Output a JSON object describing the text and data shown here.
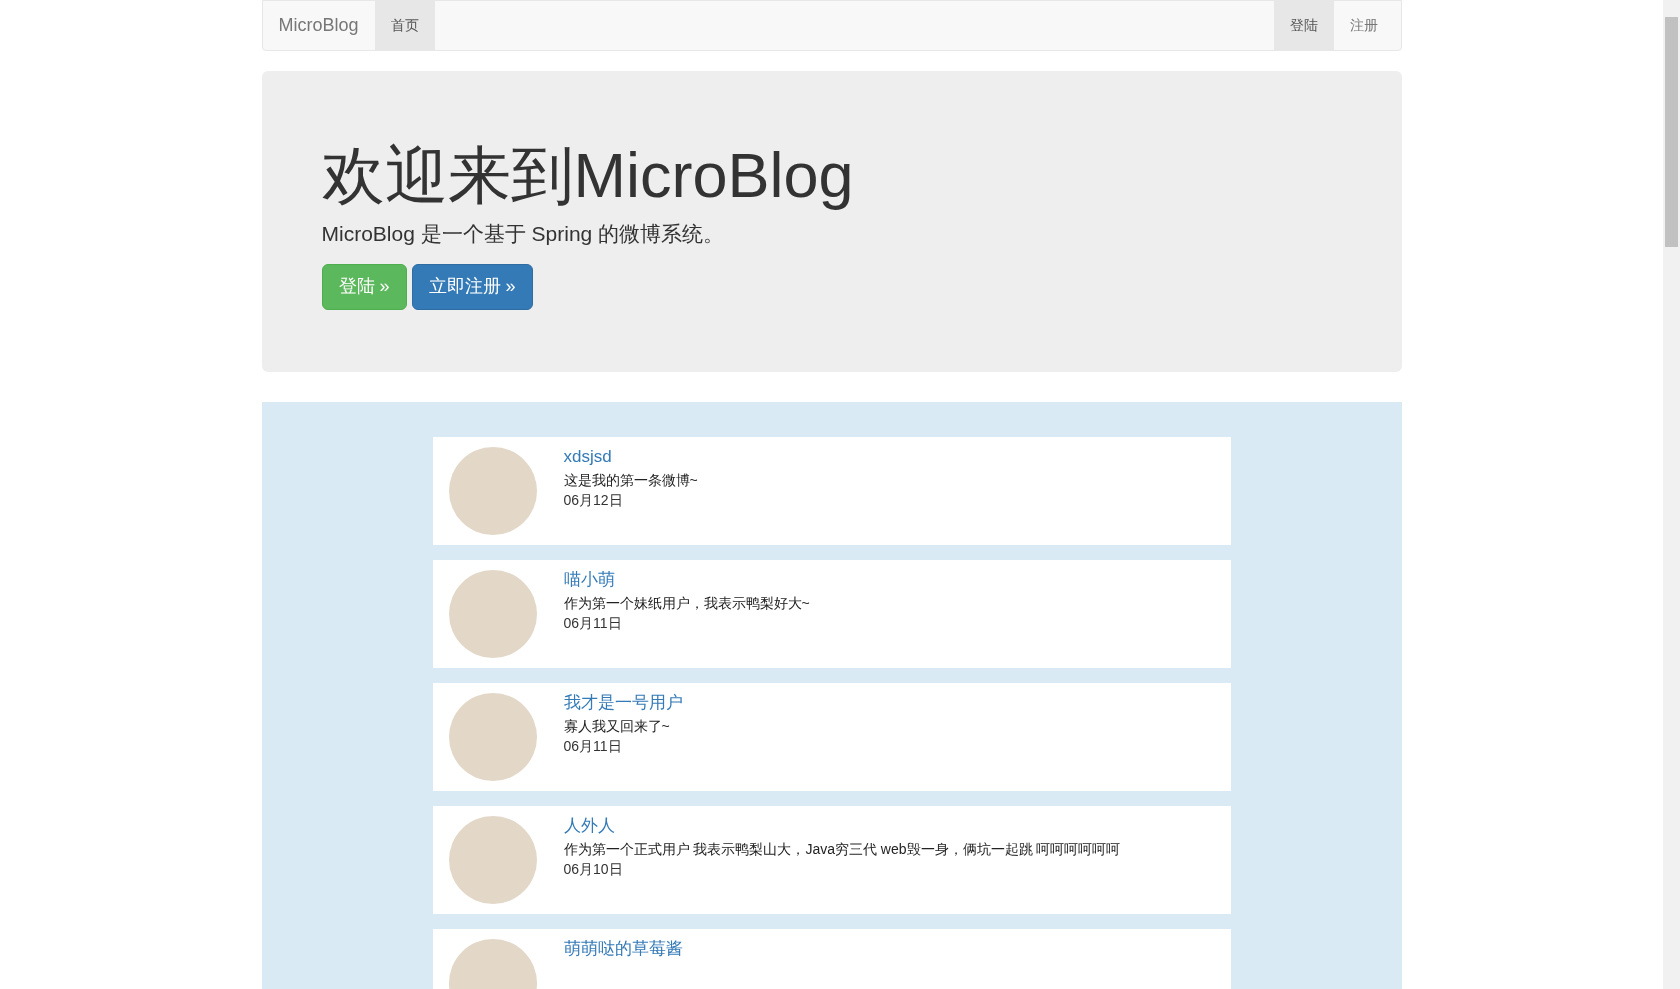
{
  "navbar": {
    "brand": "MicroBlog",
    "left_items": [
      {
        "label": "首页",
        "selected": true
      }
    ],
    "right_items": [
      {
        "label": "登陆",
        "selected": true
      },
      {
        "label": "注册",
        "selected": false
      }
    ]
  },
  "hero": {
    "title": "欢迎来到MicroBlog",
    "subtitle": "MicroBlog 是一个基于 Spring 的微博系统。",
    "buttons": [
      {
        "label": "登陆 »",
        "kind": "success"
      },
      {
        "label": "立即注册 »",
        "kind": "primary"
      }
    ]
  },
  "posts": [
    {
      "user": "xdsjsd",
      "text": "这是我的第一条微博~",
      "date": "06月12日"
    },
    {
      "user": "喵小萌",
      "text": "作为第一个妹纸用户，我表示鸭梨好大~",
      "date": "06月11日"
    },
    {
      "user": "我才是一号用户",
      "text": "寡人我又回来了~",
      "date": "06月11日"
    },
    {
      "user": "人外人",
      "text": "作为第一个正式用户 我表示鸭梨山大，Java穷三代 web毁一身，俩坑一起跳 呵呵呵呵呵呵",
      "date": "06月10日"
    },
    {
      "user": "萌萌哒的草莓酱"
    }
  ]
}
